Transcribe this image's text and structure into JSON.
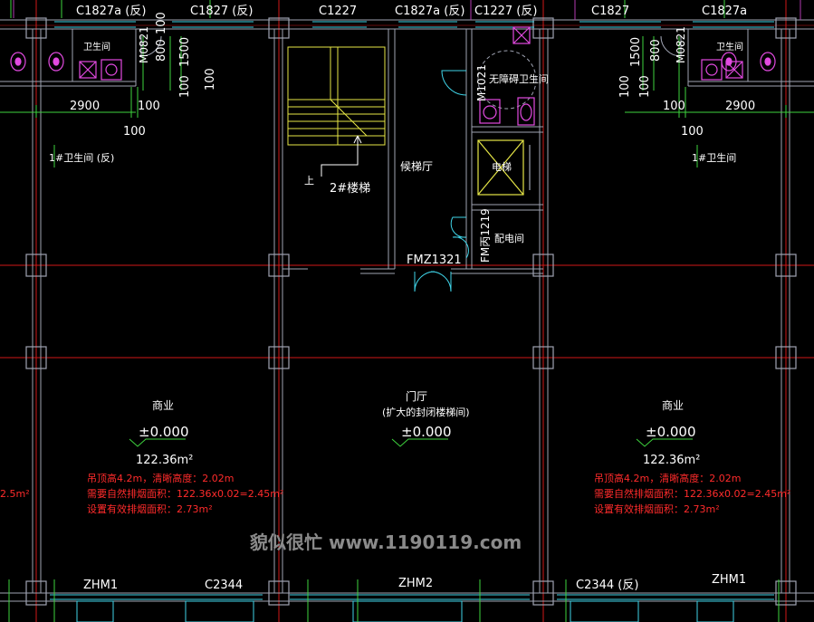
{
  "colors": {
    "background": "#000000",
    "axis_line": "#d01818",
    "wall": "#9fa3b2",
    "text": "#ffffff",
    "dim": "#3ed33e",
    "stair": "#e6e646",
    "window": "#3fd4e8",
    "fixture": "#e24ae0",
    "note": "#ff2b2b",
    "watermark": "#8a8a8a"
  },
  "windows_top": [
    "C1827a (反)",
    "C1827 (反)",
    "C1227",
    "C1827a (反)",
    "C1227 (反)",
    "C1827",
    "C1827a"
  ],
  "windows_bottom": [
    "ZHM1",
    "C2344",
    "ZHM2",
    "C2344 (反)",
    "ZHM1"
  ],
  "rooms": {
    "stair": "2#楼梯",
    "stair_up": "上",
    "waiting": "候梯厅",
    "accessible_wc": "无障碍卫生间",
    "elevator": "电梯",
    "electrical": "配电间",
    "lobby": "门厅",
    "lobby_sub": "(扩大的封闭楼梯间)",
    "left_wc": "卫生间",
    "right_wc": "卫生间",
    "left_wc_tag": "1#卫生间 (反)",
    "right_wc_tag": "1#卫生间"
  },
  "doors": {
    "left_m": "M0821",
    "right_m": "M0821",
    "accessible_m": "M1021",
    "fm_electrical": "FM丙1219",
    "fm_lobby": "FMZ1321"
  },
  "dims": {
    "d800": "800",
    "d1500": "1500",
    "d100": "100",
    "d2900": "2900"
  },
  "commercial_left": {
    "name": "商业",
    "level": "±0.000",
    "area": "122.36m²",
    "note1": "吊顶高4.2m，清晰高度：2.02m",
    "note2": "需要自然排烟面积：122.36x0.02=2.45m²",
    "note3": "设置有效排烟面积：2.73m²"
  },
  "commercial_right": {
    "name": "商业",
    "level": "±0.000",
    "area": "122.36m²",
    "note1": "吊顶高4.2m，清晰高度：2.02m",
    "note2": "需要自然排烟面积：122.36x0.02=2.45m²",
    "note3": "设置有效排烟面积：2.73m²"
  },
  "lobby_level": "±0.000",
  "edge_note": "2.5m²",
  "watermark": "貌似很忙  www.1190119.com"
}
